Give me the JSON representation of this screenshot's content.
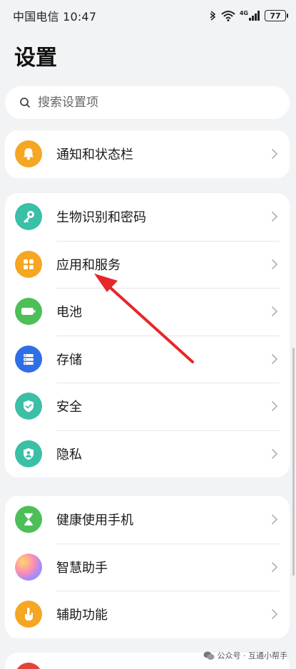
{
  "status_bar": {
    "carrier_time": "中国电信 10:47",
    "network": "4G",
    "battery": "77"
  },
  "page": {
    "title": "设置"
  },
  "search": {
    "placeholder": "搜索设置项"
  },
  "groups": [
    {
      "items": [
        {
          "label": "通知和状态栏",
          "icon": "bell-icon",
          "color": "#f5a623"
        }
      ]
    },
    {
      "items": [
        {
          "label": "生物识别和密码",
          "icon": "key-icon",
          "color": "#3bbfa7"
        },
        {
          "label": "应用和服务",
          "icon": "apps-grid-icon",
          "color": "#f5a623"
        },
        {
          "label": "电池",
          "icon": "battery-icon",
          "color": "#4cbf58"
        },
        {
          "label": "存储",
          "icon": "storage-icon",
          "color": "#2f6fe6"
        },
        {
          "label": "安全",
          "icon": "shield-icon",
          "color": "#3bbfa7"
        },
        {
          "label": "隐私",
          "icon": "privacy-icon",
          "color": "#3bbfa7"
        }
      ]
    },
    {
      "items": [
        {
          "label": "健康使用手机",
          "icon": "hourglass-icon",
          "color": "#4cbf58"
        },
        {
          "label": "智慧助手",
          "icon": "assistant-icon",
          "color": "#c58fe0"
        },
        {
          "label": "辅助功能",
          "icon": "hand-icon",
          "color": "#f5a623"
        }
      ]
    }
  ],
  "watermark": {
    "text": "公众号 · 互通小帮手"
  },
  "annotation": {
    "arrow_color": "#e8262a"
  }
}
